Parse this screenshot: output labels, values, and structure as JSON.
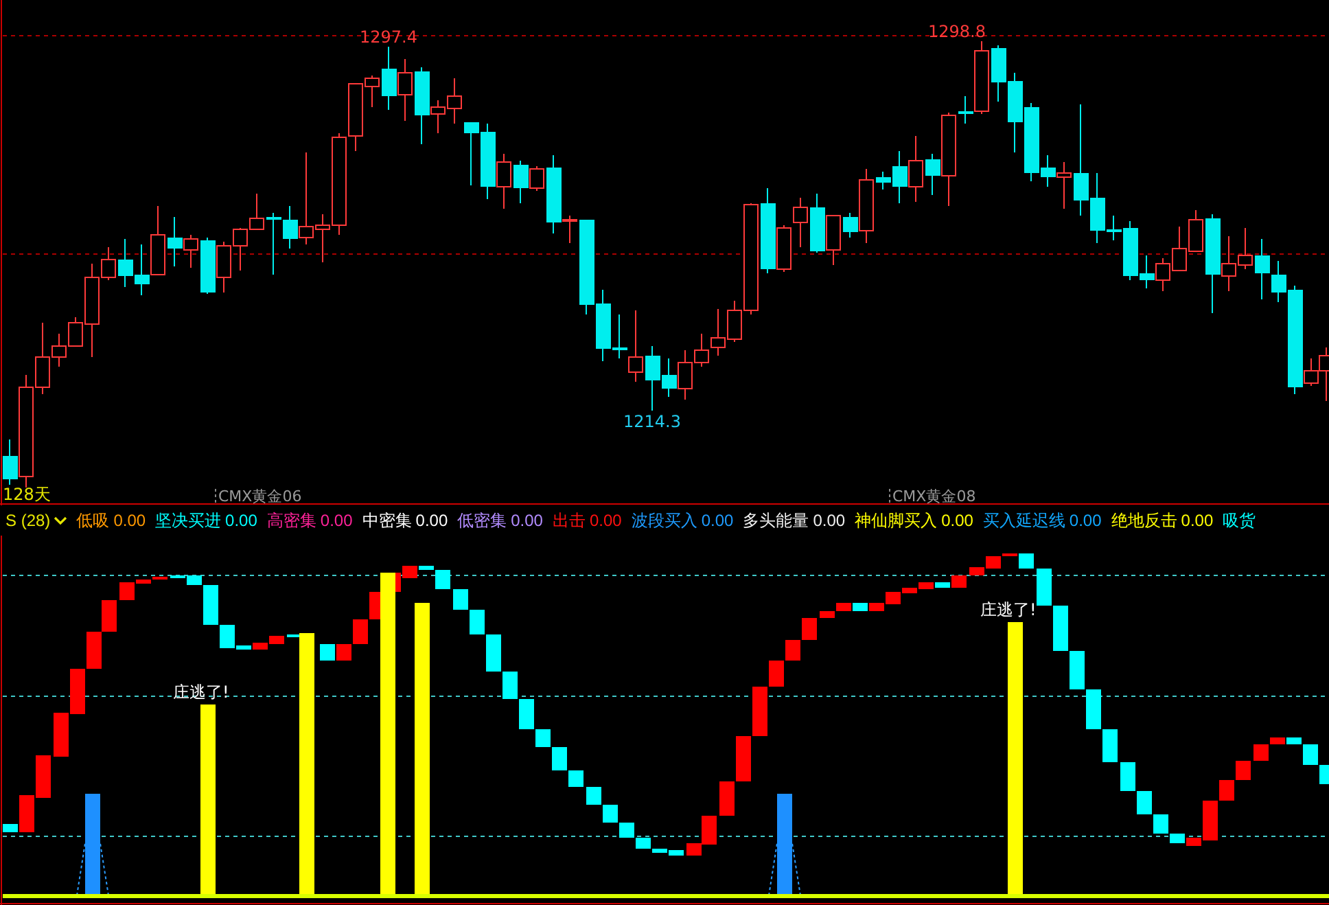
{
  "price_chart": {
    "high_labels": [
      "1297.4",
      "1298.8"
    ],
    "low_label": "1214.3",
    "period_label": "128天",
    "contract_labels": [
      "CMX黄金06",
      "CMX黄金08"
    ]
  },
  "indicator_legend": {
    "title": "S (28)",
    "items": [
      {
        "name": "低吸",
        "value": "0.00",
        "color": "#ff9900"
      },
      {
        "name": "坚决买进",
        "value": "0.00",
        "color": "#00ffff"
      },
      {
        "name": "高密集",
        "value": "0.00",
        "color": "#ff2299"
      },
      {
        "name": "中密集",
        "value": "0.00",
        "color": "#ffffff"
      },
      {
        "name": "低密集",
        "value": "0.00",
        "color": "#b38cff"
      },
      {
        "name": "出击",
        "value": "0.00",
        "color": "#ff1010"
      },
      {
        "name": "波段买入",
        "value": "0.00",
        "color": "#1e9bff"
      },
      {
        "name": "多头能量",
        "value": "0.00",
        "color": "#f0f0f0"
      },
      {
        "name": "神仙脚买入",
        "value": "0.00",
        "color": "#ffff00"
      },
      {
        "name": "买入延迟线",
        "value": "0.00",
        "color": "#12a8ff"
      },
      {
        "name": "绝地反击",
        "value": "0.00",
        "color": "#ffff00"
      },
      {
        "name": "吸货",
        "value": "",
        "color": "#00ffff"
      }
    ]
  },
  "indicator_chart": {
    "signal_labels": [
      "庄逃了!",
      "庄逃了!"
    ]
  }
}
